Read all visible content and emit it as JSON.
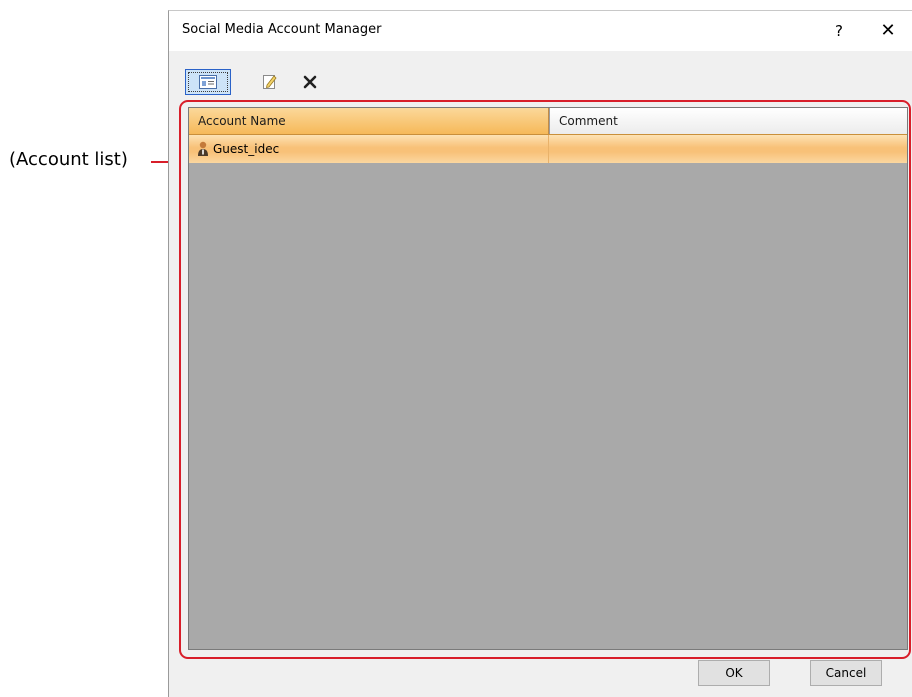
{
  "callout": {
    "label": "(Account list)"
  },
  "dialog": {
    "title": "Social Media Account Manager",
    "help_label": "?",
    "close_label": "✕"
  },
  "toolbar": {
    "items": [
      {
        "icon": "account-card-icon",
        "tooltip": ""
      },
      {
        "icon": "edit-icon",
        "tooltip": ""
      },
      {
        "icon": "delete-icon",
        "tooltip": ""
      }
    ]
  },
  "account_list": {
    "columns": [
      "Account Name",
      "Comment"
    ],
    "rows": [
      {
        "account_name": "Guest_idec",
        "comment": "",
        "icon": "user-icon"
      }
    ]
  },
  "buttons": {
    "ok": "OK",
    "cancel": "Cancel"
  },
  "colors": {
    "callout_red": "#d81e2a",
    "selected_row": "#f8c178",
    "list_bg": "#a9a9a9"
  }
}
